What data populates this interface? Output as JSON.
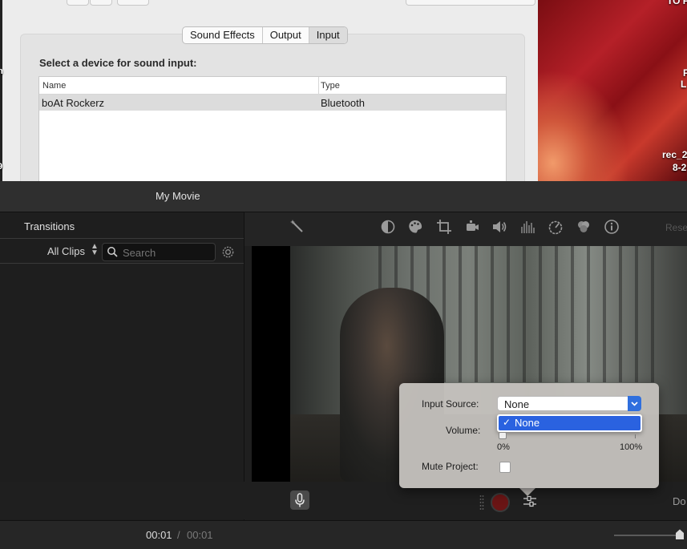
{
  "prefs": {
    "tabs": [
      {
        "label": "Sound Effects",
        "selected": false
      },
      {
        "label": "Output",
        "selected": false
      },
      {
        "label": "Input",
        "selected": true
      }
    ],
    "heading": "Select a device for sound input:",
    "columns": {
      "name": "Name",
      "type": "Type"
    },
    "devices": [
      {
        "name": "boAt Rockerz",
        "type": "Bluetooth"
      }
    ]
  },
  "desktop": {
    "labels": [
      "TO P",
      "n",
      "F",
      "L",
      "rec_2",
      "8-2",
      "9"
    ]
  },
  "imovie": {
    "title": "My Movie",
    "sidebar": {
      "transitions": "Transitions",
      "filter": "All Clips",
      "search_placeholder": "Search"
    },
    "toolbar": {
      "icons": [
        "magic-wand-icon",
        "color-balance-icon",
        "color-palette-icon",
        "crop-icon",
        "stabilization-icon",
        "volume-icon",
        "equalizer-icon",
        "speed-icon",
        "filter-icon",
        "info-icon"
      ],
      "reset_label": "Rese"
    },
    "controls": {
      "done_label": "Do"
    },
    "timeline": {
      "current": "00:01",
      "separator": "/",
      "total": "00:01",
      "zoom": 1.0
    }
  },
  "popover": {
    "input_source_label": "Input Source:",
    "input_source_value": "None",
    "dropdown_option": "None",
    "volume_label": "Volume:",
    "volume_min": "0%",
    "volume_max": "100%",
    "volume_value": 0,
    "mute_label": "Mute Project:",
    "mute_checked": false
  },
  "colors": {
    "accent": "#2a62e0",
    "record": "#6a1515"
  }
}
